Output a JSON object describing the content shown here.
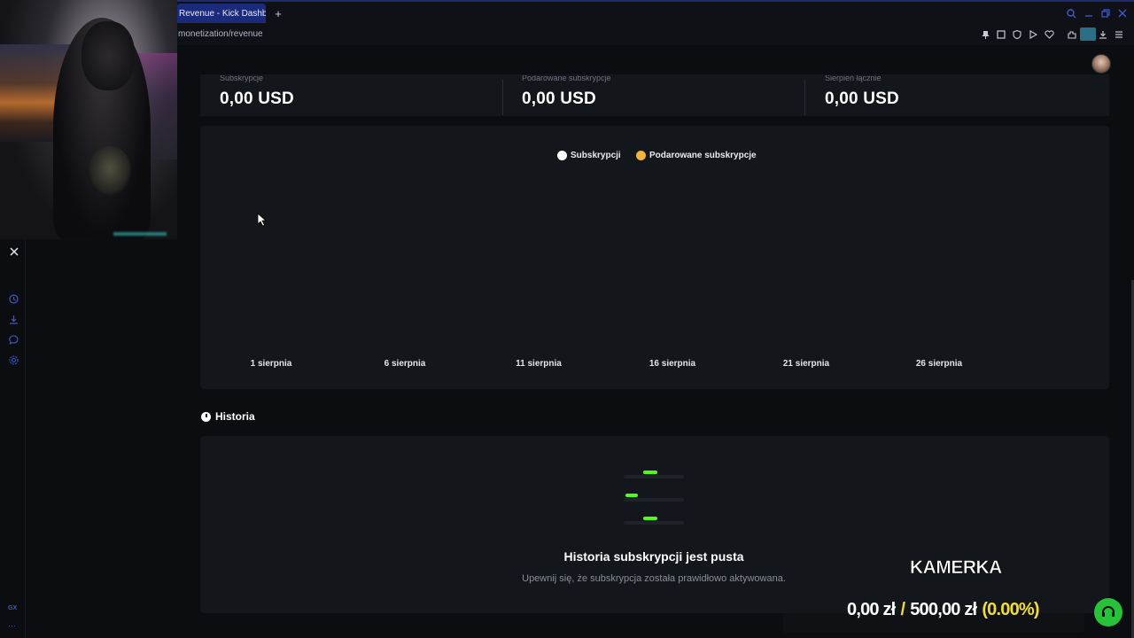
{
  "browser": {
    "active_tab_title": "Revenue - Kick Dashboar",
    "new_tab_symbol": "+",
    "url": "monetization/revenue",
    "colors": {
      "accent": "#3b5bdb",
      "tab_bg": "#1b2a7a"
    }
  },
  "sidebar": {
    "top_icon": "x-logo-icon",
    "icons": [
      "history-icon",
      "download-icon",
      "messenger-icon",
      "settings-icon"
    ],
    "bottom_labels": [
      "GX",
      "···"
    ]
  },
  "stats": [
    {
      "label": "Subskrypcje",
      "value": "0,00 USD"
    },
    {
      "label": "Podarowane subskrypcje",
      "value": "0,00 USD"
    },
    {
      "label": "Sierpień łącznie",
      "value": "0,00 USD"
    }
  ],
  "chart_data": {
    "type": "line",
    "title": "",
    "xlabel": "",
    "ylabel": "",
    "categories": [
      "1 sierpnia",
      "6 sierpnia",
      "11 sierpnia",
      "16 sierpnia",
      "21 sierpnia",
      "26 sierpnia"
    ],
    "series": [
      {
        "name": "Subskrypcji",
        "color": "#ffffff",
        "values": [
          0,
          0,
          0,
          0,
          0,
          0
        ]
      },
      {
        "name": "Podarowane subskrypcje",
        "color": "#f0b43a",
        "values": [
          0,
          0,
          0,
          0,
          0,
          0
        ]
      }
    ],
    "legend_position": "top-center",
    "grid": false
  },
  "history": {
    "title": "Historia",
    "empty_title": "Historia subskrypcji jest pusta",
    "empty_subtitle": "Upewnij się, że subskrypcja została prawidłowo aktywowana.",
    "accent": "#53fc18"
  },
  "overlay": {
    "camera_label": "KAMERKA",
    "current": "0,00 zł",
    "separator": "/",
    "goal": "500,00 zł",
    "percent": "(0.00%)",
    "goal_color": "#f0dc3a",
    "button_color": "#27c23a"
  }
}
